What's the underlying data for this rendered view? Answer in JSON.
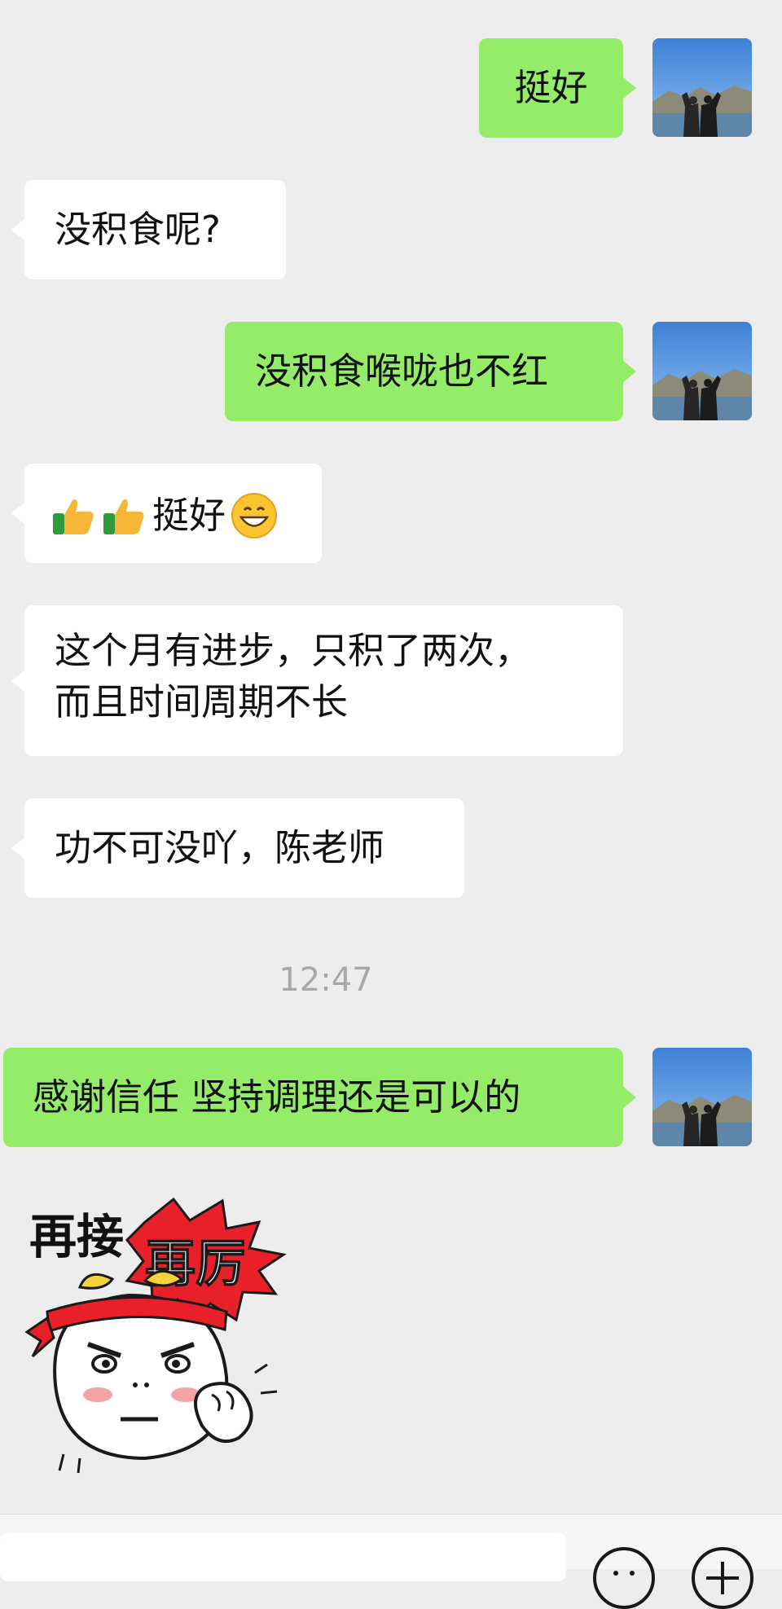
{
  "messages": [
    {
      "side": "right",
      "text": "挺好"
    },
    {
      "side": "left",
      "text": "没积食呢?"
    },
    {
      "side": "right",
      "text": "没积食喉咙也不红"
    },
    {
      "side": "left",
      "text": "挺好"
    },
    {
      "side": "left",
      "line1": "这个月有进步，只积了两次，",
      "line2": "而且时间周期不长"
    },
    {
      "side": "left",
      "text": "功不可没吖，陈老师"
    },
    {
      "side": "right",
      "text": "感谢信任 坚持调理还是可以的"
    }
  ],
  "timestamp": "12:47",
  "sticker": {
    "text1": "再接",
    "text2": "再厉"
  },
  "colors": {
    "background": "#ededed",
    "sent_bubble": "#95ec69",
    "received_bubble": "#ffffff",
    "timestamp": "#a8a8a8"
  },
  "icons": {
    "avatar": "avatar-two-people-landscape",
    "thumbs": "thumbs-up-emoji",
    "grin": "grinning-face-emoji",
    "voice": "voice-icon",
    "emoji": "emoji-icon",
    "plus": "plus-icon"
  }
}
